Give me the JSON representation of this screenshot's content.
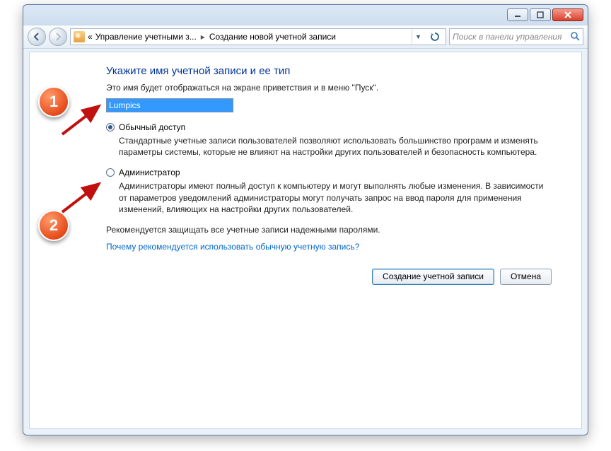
{
  "nav": {
    "crumb_prefix": "«",
    "crumb1": "Управление учетными з...",
    "crumb2": "Создание новой учетной записи",
    "search_placeholder": "Поиск в панели управления"
  },
  "page": {
    "heading": "Укажите имя учетной записи и ее тип",
    "subtext": "Это имя будет отображаться на экране приветствия и в меню \"Пуск\".",
    "account_name": "Lumpics",
    "radio_standard_label": "Обычный доступ",
    "radio_standard_desc": "Стандартные учетные записи пользователей позволяют использовать большинство программ и изменять параметры системы, которые не влияют на настройки других пользователей и безопасность компьютера.",
    "radio_admin_label": "Администратор",
    "radio_admin_desc": "Администраторы имеют полный доступ к компьютеру и могут выполнять любые изменения. В зависимости от параметров уведомлений администраторы могут получать запрос на ввод пароля для применения изменений, влияющих на настройки других пользователей.",
    "recommend_text": "Рекомендуется защищать все учетные записи надежными паролями.",
    "link_text": "Почему рекомендуется использовать обычную учетную запись?",
    "create_button": "Создание учетной записи",
    "cancel_button": "Отмена"
  },
  "annotations": {
    "badge1": "1",
    "badge2": "2"
  }
}
